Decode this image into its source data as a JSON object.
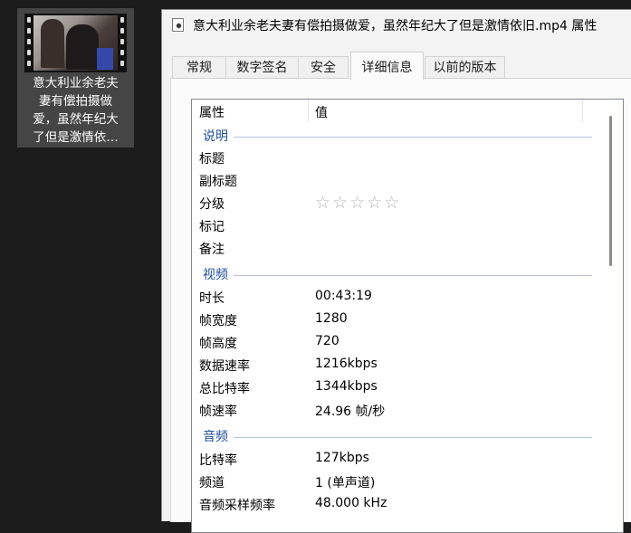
{
  "desktop_icon": {
    "label": "意大利业余老夫\n妻有偿拍摄做\n爱，虽然年纪大\n了但是激情依…"
  },
  "window": {
    "title": "意大利业余老夫妻有偿拍摄做爱，虽然年纪大了但是激情依旧.mp4 属性",
    "tabs": [
      "常规",
      "数字签名",
      "安全",
      "详细信息",
      "以前的版本"
    ],
    "active_tab": "详细信息"
  },
  "columns": {
    "property": "属性",
    "value": "值"
  },
  "groups": {
    "description": {
      "label": "说明",
      "rows": [
        {
          "key": "标题",
          "value": ""
        },
        {
          "key": "副标题",
          "value": ""
        },
        {
          "key": "分级",
          "value": ""
        },
        {
          "key": "标记",
          "value": ""
        },
        {
          "key": "备注",
          "value": ""
        }
      ],
      "rating_stars": "☆☆☆☆☆"
    },
    "video": {
      "label": "视频",
      "rows": [
        {
          "key": "时长",
          "value": "00:43:19"
        },
        {
          "key": "帧宽度",
          "value": "1280"
        },
        {
          "key": "帧高度",
          "value": "720"
        },
        {
          "key": "数据速率",
          "value": "1216kbps"
        },
        {
          "key": "总比特率",
          "value": "1344kbps"
        },
        {
          "key": "帧速率",
          "value": "24.96 帧/秒"
        }
      ]
    },
    "audio": {
      "label": "音频",
      "rows": [
        {
          "key": "比特率",
          "value": "127kbps"
        },
        {
          "key": "频道",
          "value": "1 (单声道)"
        },
        {
          "key": "音频采样频率",
          "value": "48.000 kHz"
        }
      ]
    }
  },
  "colors": {
    "group_label": "#1f4f96",
    "desktop_bg": "#1c1c1c",
    "window_bg": "#f3f3f3"
  }
}
